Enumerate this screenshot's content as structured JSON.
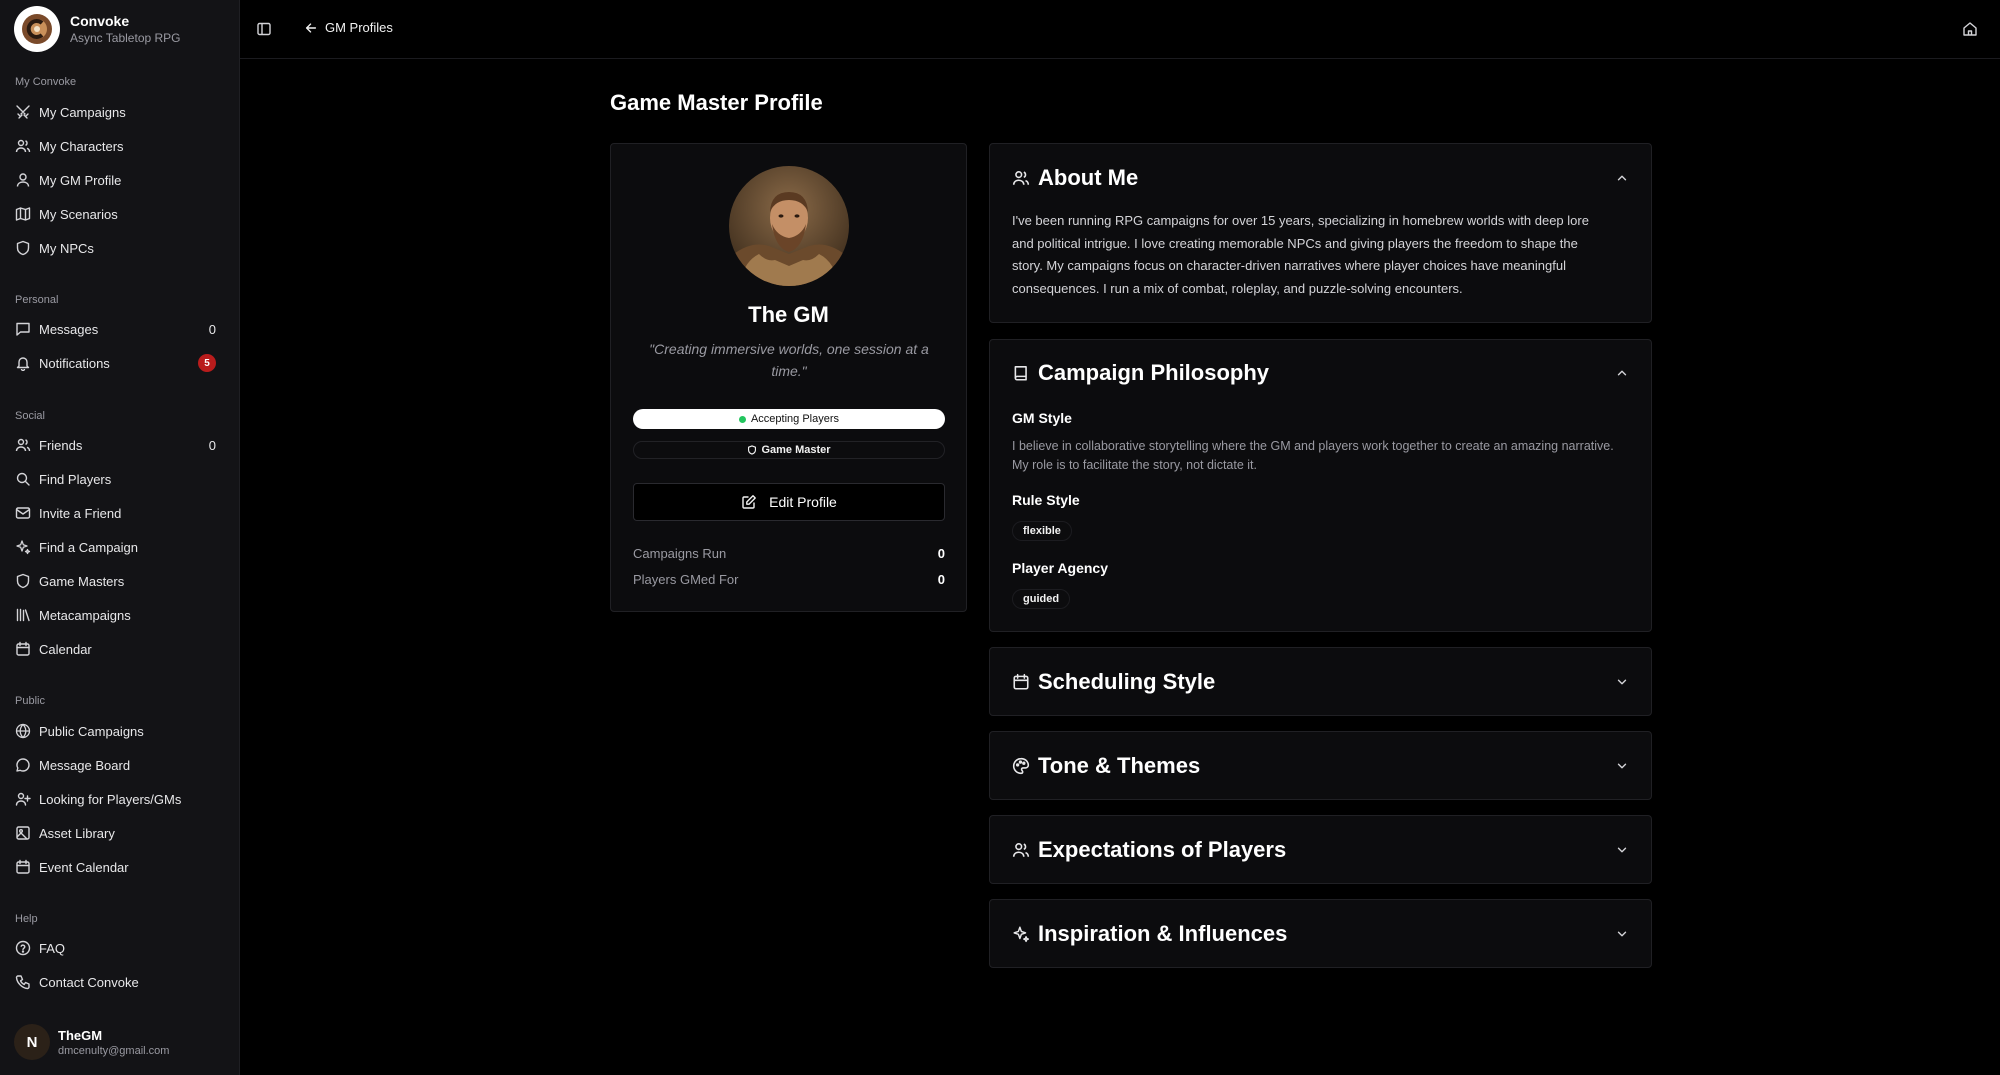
{
  "app": {
    "name": "Convoke",
    "tagline": "Async Tabletop RPG"
  },
  "sidebar": {
    "groups": [
      {
        "label": "My Convoke",
        "items": [
          {
            "label": "My Campaigns",
            "icon": "swords-icon"
          },
          {
            "label": "My Characters",
            "icon": "users-icon"
          },
          {
            "label": "My GM Profile",
            "icon": "user-icon"
          },
          {
            "label": "My Scenarios",
            "icon": "map-icon"
          },
          {
            "label": "My NPCs",
            "icon": "shield-icon"
          }
        ]
      },
      {
        "label": "Personal",
        "items": [
          {
            "label": "Messages",
            "icon": "message-icon",
            "count": "0"
          },
          {
            "label": "Notifications",
            "icon": "bell-icon",
            "badge": "5"
          }
        ]
      },
      {
        "label": "Social",
        "items": [
          {
            "label": "Friends",
            "icon": "users-icon",
            "count": "0"
          },
          {
            "label": "Find Players",
            "icon": "search-icon"
          },
          {
            "label": "Invite a Friend",
            "icon": "mail-icon"
          },
          {
            "label": "Find a Campaign",
            "icon": "sparkles-icon"
          },
          {
            "label": "Game Masters",
            "icon": "shield-icon"
          },
          {
            "label": "Metacampaigns",
            "icon": "library-icon"
          },
          {
            "label": "Calendar",
            "icon": "calendar-icon"
          }
        ]
      },
      {
        "label": "Public",
        "items": [
          {
            "label": "Public Campaigns",
            "icon": "globe-icon"
          },
          {
            "label": "Message Board",
            "icon": "message-circle-icon"
          },
          {
            "label": "Looking for Players/GMs",
            "icon": "user-plus-icon"
          },
          {
            "label": "Asset Library",
            "icon": "image-icon"
          },
          {
            "label": "Event Calendar",
            "icon": "calendar-icon"
          }
        ]
      },
      {
        "label": "Help",
        "items": [
          {
            "label": "FAQ",
            "icon": "help-circle-icon"
          },
          {
            "label": "Contact Convoke",
            "icon": "phone-icon"
          }
        ]
      }
    ]
  },
  "user": {
    "initial": "N",
    "name": "TheGM",
    "email": "dmcenulty@gmail.com"
  },
  "topbar": {
    "back_label": "GM Profiles"
  },
  "page": {
    "title": "Game Master Profile"
  },
  "profile": {
    "name": "The GM",
    "quote": "\"Creating immersive worlds, one session at a time.\"",
    "status": "Accepting Players",
    "role": "Game Master",
    "edit_label": "Edit Profile",
    "stats": [
      {
        "label": "Campaigns Run",
        "value": "0"
      },
      {
        "label": "Players GMed For",
        "value": "0"
      }
    ]
  },
  "about": {
    "title": "About Me",
    "text": "I've been running RPG campaigns for over 15 years, specializing in homebrew worlds with deep lore and political intrigue. I love creating memorable NPCs and giving players the freedom to shape the story. My campaigns focus on character-driven narratives where player choices have meaningful consequences. I run a mix of combat, roleplay, and puzzle-solving encounters."
  },
  "philosophy": {
    "title": "Campaign Philosophy",
    "gm_style_label": "GM Style",
    "gm_style_text": "I believe in collaborative storytelling where the GM and players work together to create an amazing narrative. My role is to facilitate the story, not dictate it.",
    "rule_style_label": "Rule Style",
    "rule_style_value": "flexible",
    "agency_label": "Player Agency",
    "agency_value": "guided"
  },
  "collapsed_sections": [
    {
      "title": "Scheduling Style",
      "icon": "calendar-icon"
    },
    {
      "title": "Tone & Themes",
      "icon": "palette-icon"
    },
    {
      "title": "Expectations of Players",
      "icon": "users-icon"
    },
    {
      "title": "Inspiration & Influences",
      "icon": "sparkles-icon"
    }
  ],
  "colors": {
    "accent_dot": "#22c55e",
    "badge": "#b91c1c",
    "background": "#000000",
    "card": "#0c0c0e"
  }
}
